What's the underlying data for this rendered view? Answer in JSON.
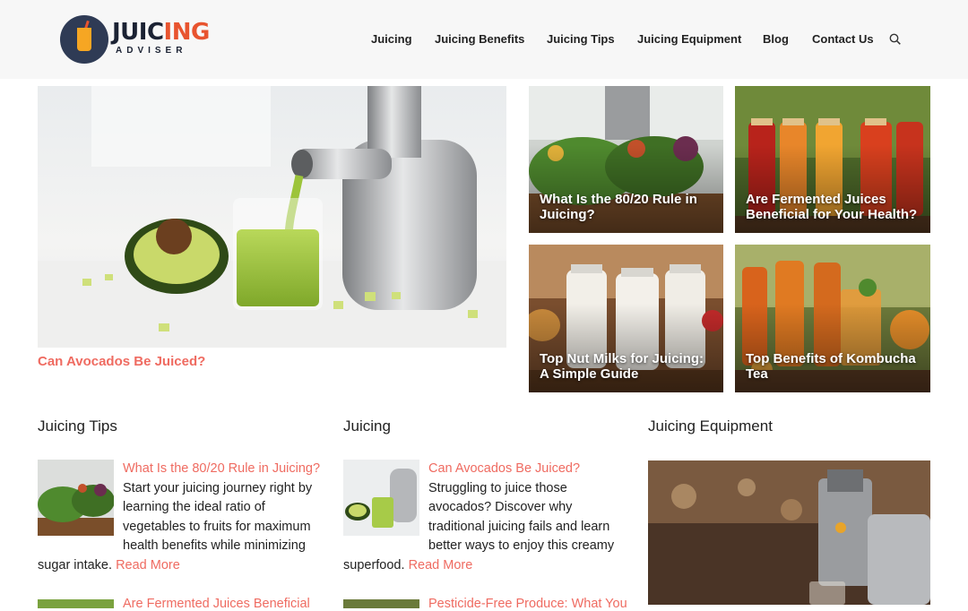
{
  "brand": {
    "word_main": "JUIC",
    "word_accent": "ING",
    "sub": "ADVISER",
    "accent_color": "#e8542f"
  },
  "nav": {
    "items": [
      {
        "label": "Juicing"
      },
      {
        "label": "Juicing Benefits"
      },
      {
        "label": "Juicing Tips"
      },
      {
        "label": "Juicing Equipment"
      },
      {
        "label": "Blog"
      },
      {
        "label": "Contact Us"
      }
    ],
    "search_icon": "search-icon"
  },
  "hero": {
    "caption": "Can Avocados Be Juiced?"
  },
  "tiles": [
    {
      "title": "What Is the 80/20 Rule in Juicing?"
    },
    {
      "title": "Are Fermented Juices Beneficial for Your Health?"
    },
    {
      "title": "Top Nut Milks for Juicing: A Simple Guide"
    },
    {
      "title": "Top Benefits of Kombucha Tea"
    }
  ],
  "sections": {
    "tips": {
      "title": "Juicing Tips",
      "post_title": "What Is the 80/20 Rule in Juicing?",
      "excerpt": "Start your juicing journey right by learning the ideal ratio of vegetables to fruits for maximum health benefits while minimizing sugar intake.",
      "more": "Read More",
      "next_title": "Are Fermented Juices Beneficial"
    },
    "juicing": {
      "title": "Juicing",
      "post_title": "Can Avocados Be Juiced?",
      "excerpt": "Struggling to juice those avocados? Discover why traditional juicing fails and learn better ways to enjoy this creamy superfood.",
      "more": "Read More",
      "next_title": "Pesticide-Free Produce: What You"
    },
    "equipment": {
      "title": "Juicing Equipment"
    }
  },
  "colors": {
    "link": "#ef6b61",
    "header_bg": "#f7f7f7"
  }
}
